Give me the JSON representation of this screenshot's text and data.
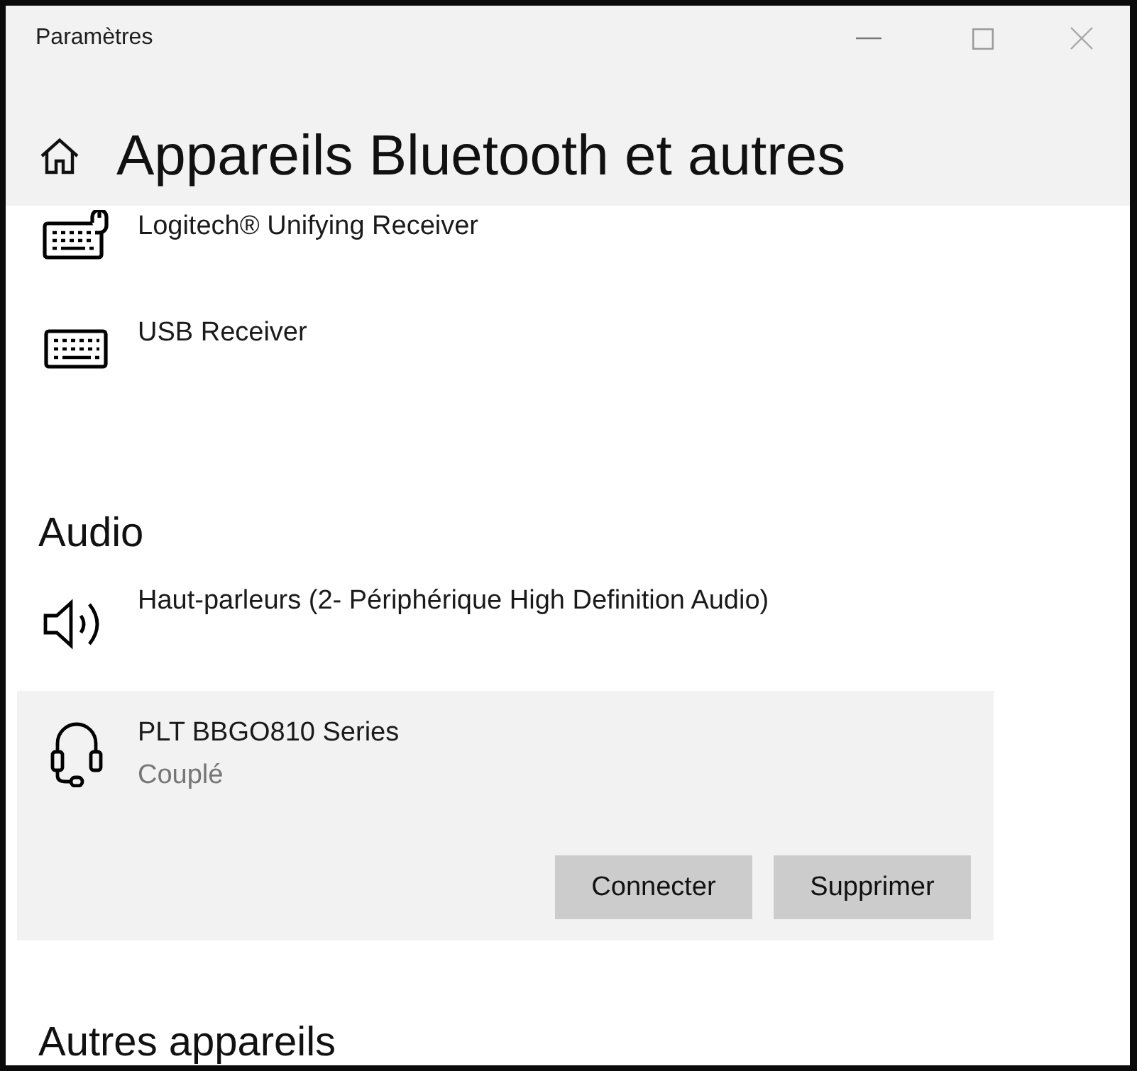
{
  "window": {
    "title": "Paramètres"
  },
  "page": {
    "title": "Appareils Bluetooth et autres"
  },
  "sections": [
    {
      "items": [
        {
          "kind": "keyboard-mouse",
          "name": "Logitech® Unifying Receiver",
          "selected": false
        },
        {
          "kind": "keyboard",
          "name": "USB Receiver",
          "selected": false
        }
      ]
    },
    {
      "heading": "Audio",
      "items": [
        {
          "kind": "speaker",
          "name": "Haut-parleurs (2- Périphérique High Definition Audio)",
          "selected": false
        },
        {
          "kind": "headset",
          "name": "PLT BBGO810 Series",
          "status": "Couplé",
          "selected": true,
          "actions": [
            "Connecter",
            "Supprimer"
          ]
        }
      ]
    },
    {
      "heading": "Autres appareils"
    }
  ]
}
